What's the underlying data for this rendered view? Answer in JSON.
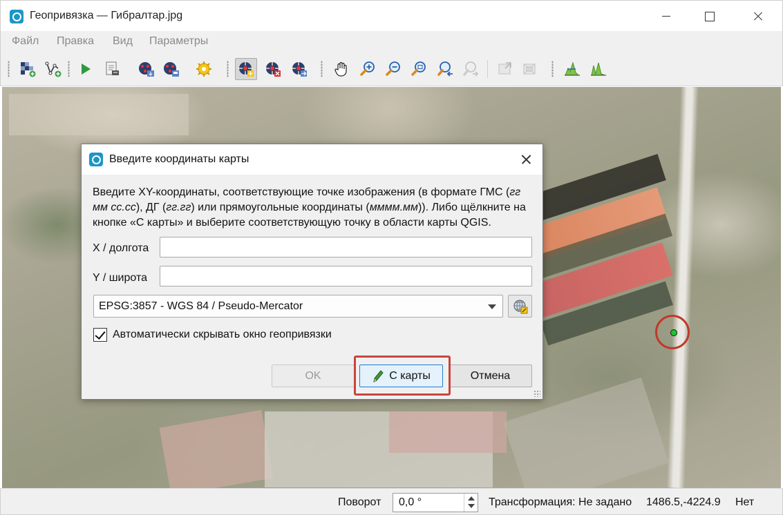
{
  "window": {
    "title": "Геопривязка — Гибралтар.jpg"
  },
  "menu": {
    "file": "Файл",
    "edit": "Правка",
    "view": "Вид",
    "settings": "Параметры"
  },
  "toolbar": {
    "icons": [
      "open-raster-icon",
      "open-vector-icon",
      "start-georef-icon",
      "generate-gdal-script-icon",
      "load-gcp-icon",
      "save-gcp-icon",
      "transform-settings-icon",
      "add-point-icon",
      "delete-point-icon",
      "move-point-icon",
      "pan-icon",
      "zoom-in-icon",
      "zoom-out-icon",
      "zoom-to-layer-icon",
      "zoom-last-icon",
      "zoom-next-icon",
      "link-georef-to-qgis-icon",
      "link-qgis-to-georef-icon",
      "local-histogram-stretch-icon",
      "full-histogram-stretch-icon"
    ]
  },
  "dialog": {
    "title": "Введите координаты карты",
    "instructions_p1": "Введите XY-координаты, соответствующие точке изображения (в формате ГМС (",
    "instructions_i1": "гг мм сс.сс",
    "instructions_p2": "), ДГ (",
    "instructions_i2": "гг.гг",
    "instructions_p3": ") или прямоугольные координаты (",
    "instructions_i3": "мммм.мм",
    "instructions_p4": ")). Либо щёлкните на кнопке «С карты» и выберите соответствующую точку в области карты QGIS.",
    "x_label": "X / долгота",
    "x_value": "",
    "y_label": "Y / широта",
    "y_value": "",
    "crs_value": "EPSG:3857 - WGS 84 / Pseudo-Mercator",
    "auto_hide_label": "Автоматически скрывать окно геопривязки",
    "auto_hide_checked": true,
    "ok_label": "OK",
    "from_map_label": "С карты",
    "cancel_label": "Отмена"
  },
  "status": {
    "rotation_label": "Поворот",
    "rotation_value": "0,0 °",
    "transform_label": "Трансформация: Не задано",
    "coordinates": "1486.5,-4224.9",
    "crs_label": "Нет"
  },
  "colors": {
    "accent": "#1f7ad3",
    "highlight_frame": "#c8453c",
    "marker_ring": "#c0392b",
    "marker_dot": "#1fc42a",
    "qgis_icon": "#1b96c6"
  }
}
